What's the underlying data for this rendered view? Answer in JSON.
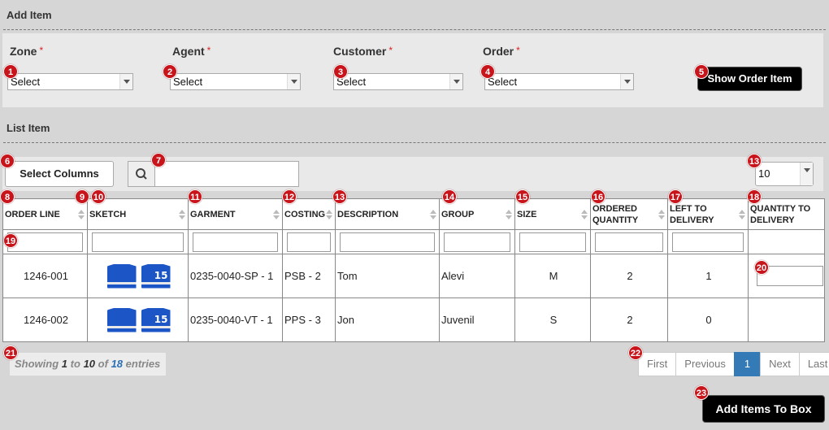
{
  "add_item": {
    "title": "Add Item",
    "zone": {
      "label": "Zone",
      "value": "Select"
    },
    "agent": {
      "label": "Agent",
      "value": "Select"
    },
    "customer": {
      "label": "Customer",
      "value": "Select"
    },
    "order": {
      "label": "Order",
      "value": "Select"
    },
    "required_mark": "*",
    "show_button": "Show Order Item"
  },
  "list_item": {
    "title": "List Item",
    "select_columns": "Select Columns",
    "page_size": "10",
    "columns": [
      "ORDER LINE",
      "SKETCH",
      "GARMENT",
      "COSTING",
      "DESCRIPTION",
      "GROUP",
      "SIZE",
      "ORDERED QUANTITY",
      "LEFT TO DELIVERY",
      "QUANTITY TO DELIVERY"
    ],
    "rows": [
      {
        "order_line": "1246-001",
        "garment": "0235-0040-SP - 1",
        "costing": "PSB - 2",
        "description": "Tom",
        "group": "Alevi",
        "size": "M",
        "ordered": "2",
        "left": "1"
      },
      {
        "order_line": "1246-002",
        "garment": "0235-0040-VT - 1",
        "costing": "PPS - 3",
        "description": "Jon",
        "group": "Juvenil",
        "size": "S",
        "ordered": "2",
        "left": "0"
      }
    ],
    "info": {
      "showing": "Showing",
      "from": "1",
      "to_word": "to",
      "to": "10",
      "of_word": "of",
      "total": "18",
      "entries": "entries"
    },
    "pager": {
      "first": "First",
      "previous": "Previous",
      "current": "1",
      "next": "Next",
      "last": "Last"
    },
    "add_button": "Add Items To Box",
    "sketch_number": "15"
  },
  "badges": [
    "1",
    "2",
    "3",
    "4",
    "5",
    "6",
    "7",
    "13",
    "8",
    "9",
    "10",
    "11",
    "12",
    "13",
    "14",
    "15",
    "16",
    "17",
    "18",
    "19",
    "20",
    "21",
    "22",
    "23"
  ],
  "colors": {
    "badge": "#c8141b",
    "primary_button": "#000000",
    "pager_active": "#337ab7",
    "background": "#d6d6d6"
  }
}
